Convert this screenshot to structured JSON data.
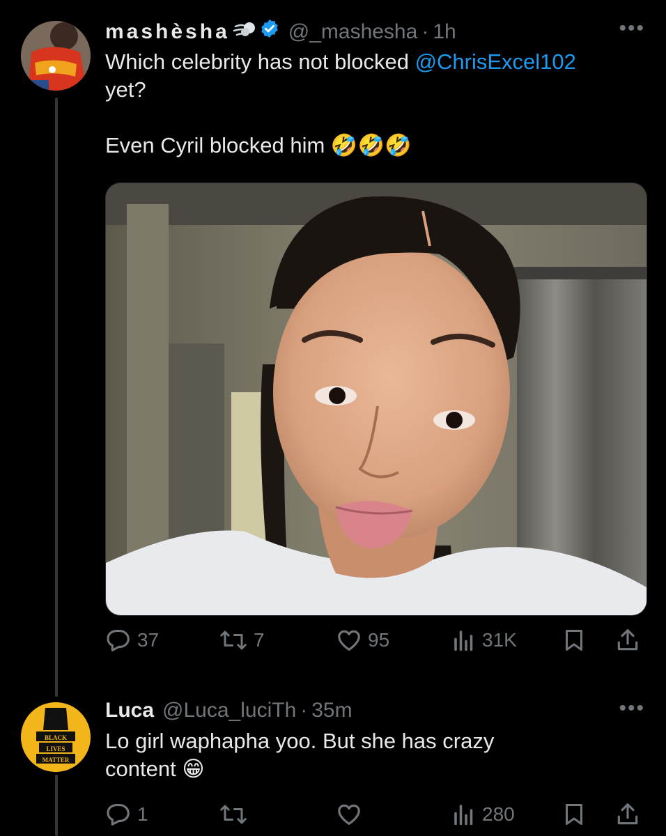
{
  "thread": {
    "main_post": {
      "display_name": "mashèsha",
      "handle": "@_mashesha",
      "time": "1h",
      "text_line1": "Which celebrity has not blocked ",
      "mention": "@ChrisExcel102",
      "text_line2": "yet?",
      "text_line3": "Even Cyril blocked him",
      "emoji": "🤣🤣🤣",
      "stats": {
        "replies": "37",
        "reposts": "7",
        "likes": "95",
        "views": "31K"
      }
    },
    "reply": {
      "display_name": "Luca",
      "handle": "@Luca_luciTh",
      "time": "35m",
      "text_line1": "Lo girl waphapha yoo. But she has crazy",
      "text_line2": "content",
      "emoji": "😁",
      "avatar_text": [
        "BLACK",
        "LIVES",
        "MATTER"
      ],
      "stats": {
        "replies": "1",
        "views": "280"
      }
    },
    "more_label": "•••",
    "dot": "·"
  },
  "colors": {
    "background": "#000000",
    "text": "#e7e9ea",
    "muted": "#71767b",
    "accent": "#1d9bf0",
    "verified": "#1d9bf0"
  }
}
